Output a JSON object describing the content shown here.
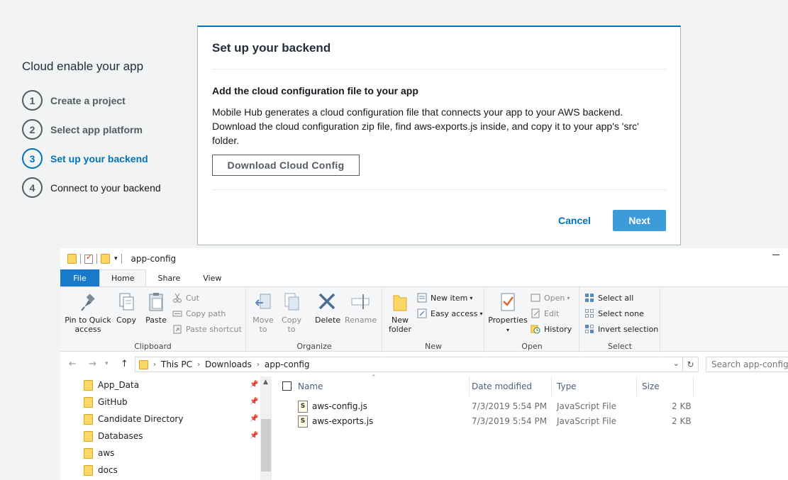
{
  "wizard": {
    "title": "Cloud enable your app",
    "steps": [
      {
        "num": "1",
        "label": "Create a project"
      },
      {
        "num": "2",
        "label": "Select app platform"
      },
      {
        "num": "3",
        "label": "Set up your backend"
      },
      {
        "num": "4",
        "label": "Connect to your backend"
      }
    ],
    "active_step": 3
  },
  "panel": {
    "heading": "Set up your backend",
    "subheading": "Add the cloud configuration file to your app",
    "body": "Mobile Hub generates a cloud configuration file that connects your app to your AWS backend. Download the cloud configuration zip file, find aws-exports.js inside, and copy it to your app's 'src' folder.",
    "download_button": "Download Cloud Config",
    "cancel_button": "Cancel",
    "next_button": "Next"
  },
  "explorer": {
    "window_title": "app-config",
    "tabs": {
      "file": "File",
      "home": "Home",
      "share": "Share",
      "view": "View"
    },
    "ribbon": {
      "clipboard": {
        "label": "Clipboard",
        "pin_to_quick_access": "Pin to Quick access",
        "copy": "Copy",
        "paste": "Paste",
        "cut": "Cut",
        "copy_path": "Copy path",
        "paste_shortcut": "Paste shortcut"
      },
      "organize": {
        "label": "Organize",
        "move_to": "Move to",
        "copy_to": "Copy to",
        "delete": "Delete",
        "rename": "Rename"
      },
      "new": {
        "label": "New",
        "new_folder": "New folder",
        "new_item": "New item",
        "easy_access": "Easy access"
      },
      "open": {
        "label": "Open",
        "properties": "Properties",
        "open": "Open",
        "edit": "Edit",
        "history": "History"
      },
      "select": {
        "label": "Select",
        "select_all": "Select all",
        "select_none": "Select none",
        "invert_selection": "Invert selection"
      }
    },
    "address": {
      "crumbs": [
        "This PC",
        "Downloads",
        "app-config"
      ],
      "search_placeholder": "Search app-config"
    },
    "nav_items": [
      {
        "name": "App_Data",
        "pinned": true
      },
      {
        "name": "GitHub",
        "pinned": true
      },
      {
        "name": "Candidate Directory",
        "pinned": true
      },
      {
        "name": "Databases",
        "pinned": true
      },
      {
        "name": "aws",
        "pinned": false
      },
      {
        "name": "docs",
        "pinned": false
      }
    ],
    "columns": {
      "name": "Name",
      "date": "Date modified",
      "type": "Type",
      "size": "Size"
    },
    "files": [
      {
        "name": "aws-config.js",
        "date": "7/3/2019 5:54 PM",
        "type": "JavaScript File",
        "size": "2 KB"
      },
      {
        "name": "aws-exports.js",
        "date": "7/3/2019 5:54 PM",
        "type": "JavaScript File",
        "size": "2 KB"
      }
    ]
  }
}
